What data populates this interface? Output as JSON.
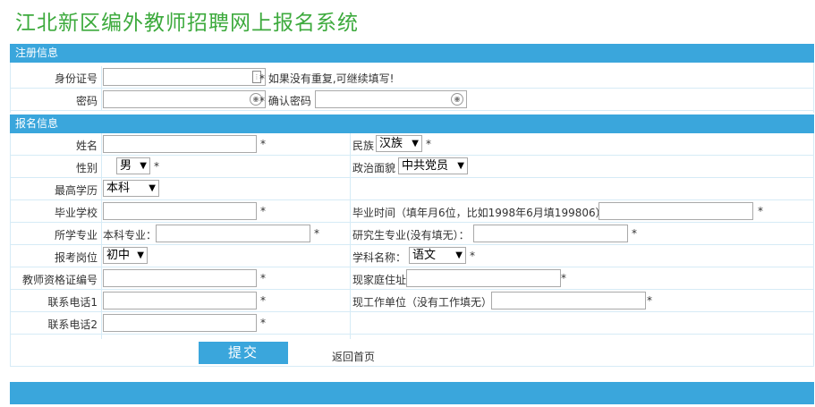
{
  "page_title": "江北新区编外教师招聘网上报名系统",
  "section_register": "注册信息",
  "section_apply": "报名信息",
  "register": {
    "id_label": "身份证号",
    "id_hint": "* 如果没有重复,可继续填写!",
    "password_label": "密码",
    "confirm_label": "* 确认密码"
  },
  "apply": {
    "name_label": "姓名",
    "ethnicity_label": "民族",
    "ethnicity_value": "汉族",
    "gender_label": "性别",
    "gender_value": "男",
    "political_label": "政治面貌",
    "political_value": "中共党员",
    "education_label": "最高学历",
    "education_value": "本科",
    "school_label": "毕业学校",
    "grad_time_label": "毕业时间（填年月6位，比如1998年6月填199806）",
    "major_label": "所学专业",
    "undergrad_major_label": "本科专业：",
    "grad_major_label": "研究生专业(没有填无）：",
    "position_label": "报考岗位",
    "position_value": "初中",
    "subject_label": "学科名称：",
    "subject_value": "语文",
    "cert_label": "教师资格证编号",
    "address_label": "现家庭住址",
    "phone1_label": "联系电话1",
    "workplace_label": "现工作单位（没有工作填无）",
    "phone2_label": "联系电话2",
    "star": "*"
  },
  "actions": {
    "submit_label": "提交",
    "back_label": "返回首页"
  }
}
